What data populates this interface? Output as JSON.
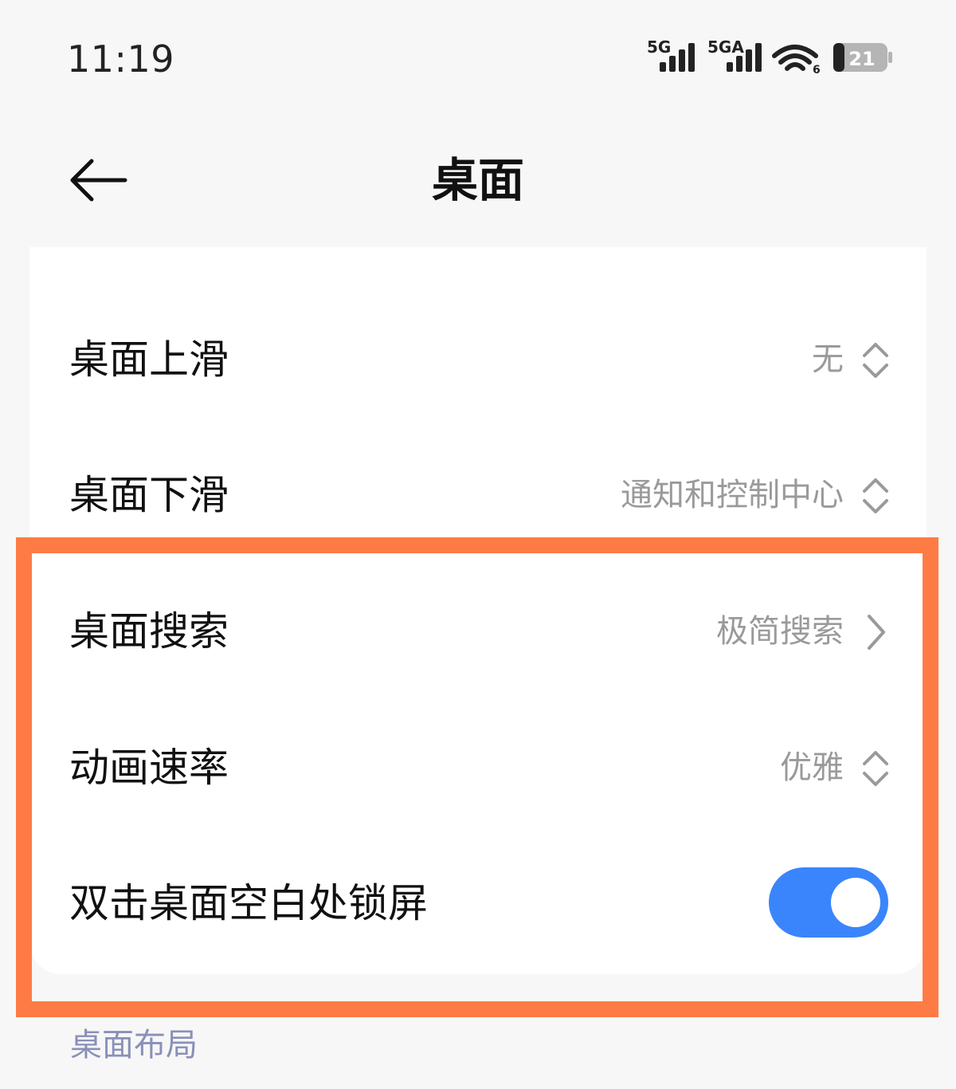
{
  "status_bar": {
    "time": "11:19",
    "sim1_label": "5G",
    "sim2_label": "5GA",
    "wifi_badge": "6",
    "battery_level": "21",
    "icons": [
      "signal-icon",
      "signal-icon",
      "wifi-icon",
      "battery-icon"
    ]
  },
  "header": {
    "title": "桌面",
    "back_icon": "back-arrow-icon"
  },
  "settings": {
    "rows": [
      {
        "label": "桌面上滑",
        "value": "无",
        "control": "selector",
        "icon": "up-down-chevron-icon"
      },
      {
        "label": "桌面下滑",
        "value": "通知和控制中心",
        "control": "selector",
        "icon": "up-down-chevron-icon"
      },
      {
        "label": "桌面搜索",
        "value": "极简搜索",
        "control": "link",
        "icon": "chevron-right-icon"
      },
      {
        "label": "动画速率",
        "value": "优雅",
        "control": "selector",
        "icon": "up-down-chevron-icon"
      },
      {
        "label": "双击桌面空白处锁屏",
        "control": "toggle",
        "toggle_on": true
      }
    ]
  },
  "section": {
    "title": "桌面布局"
  },
  "colors": {
    "accent": "#3a85fb",
    "highlight": "#ff7b45",
    "section_header": "#8a90b8",
    "secondary_text": "#9a9a9a"
  }
}
